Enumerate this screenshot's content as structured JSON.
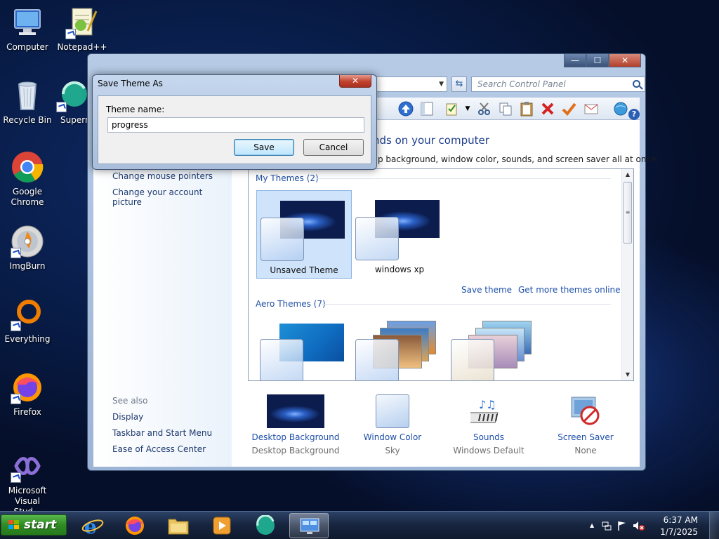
{
  "desktop": {
    "icons": [
      {
        "label": "Computer"
      },
      {
        "label": "Notepad++"
      },
      {
        "label": "Recycle Bin"
      },
      {
        "label": "Supern"
      },
      {
        "label": "Google Chrome"
      },
      {
        "label": "ImgBurn"
      },
      {
        "label": "Everything"
      },
      {
        "label": "Firefox"
      },
      {
        "label": "Microsoft Visual Stud..."
      }
    ]
  },
  "window": {
    "captions": {
      "minimize": "—",
      "maximize": "☐",
      "close": "✕"
    },
    "search_placeholder": "Search Control Panel",
    "sidebar": {
      "links": [
        "Change mouse pointers",
        "Change your account picture"
      ],
      "see_also_label": "See also",
      "see_also": [
        "Display",
        "Taskbar and Start Menu",
        "Ease of Access Center"
      ]
    },
    "content_title": "nds on your computer",
    "content_desc": "p background, window color, sounds, and screen saver all at once.",
    "my_themes": {
      "header": "My Themes (2)",
      "themes": [
        {
          "name": "Unsaved Theme",
          "selected": true
        },
        {
          "name": "windows xp",
          "selected": false
        }
      ],
      "links": {
        "save": "Save theme",
        "more": "Get more themes online"
      }
    },
    "aero_themes": {
      "header": "Aero Themes (7)"
    },
    "bottom": [
      {
        "link": "Desktop Background",
        "sub": "Desktop Background"
      },
      {
        "link": "Window Color",
        "sub": "Sky"
      },
      {
        "link": "Sounds",
        "sub": "Windows Default"
      },
      {
        "link": "Screen Saver",
        "sub": "None"
      }
    ]
  },
  "dialog": {
    "title": "Save Theme As",
    "close": "✕",
    "label": "Theme name:",
    "value": "progress",
    "save": "Save",
    "cancel": "Cancel"
  },
  "taskbar": {
    "start": "start",
    "time": "6:37 AM",
    "date": "1/7/2025",
    "tray_up_arrow": "▲"
  },
  "colors": {
    "link": "#1e4fa8",
    "start_green": "#2f8b23",
    "close_red": "#c1402c"
  }
}
